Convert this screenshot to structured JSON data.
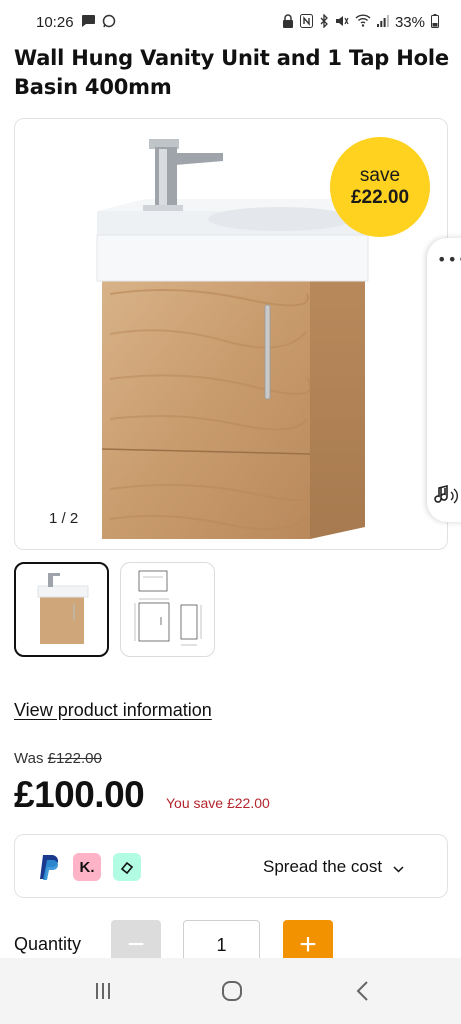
{
  "status_bar": {
    "time": "10:26",
    "battery": "33%",
    "icons": [
      "chat-icon",
      "whatsapp-icon",
      "lock-icon",
      "nfc-icon",
      "bluetooth-icon",
      "mute-icon",
      "wifi-icon",
      "signal-icon",
      "battery-icon"
    ]
  },
  "product": {
    "title_line1": "Wall Hung Vanity Unit and 1 Tap Hole",
    "title_line2": "Basin 400mm"
  },
  "gallery": {
    "save_badge_line1": "save",
    "save_badge_line2": "£22.00",
    "counter": "1 / 2",
    "badge_color": "#ffd21f"
  },
  "links": {
    "view_product_info": "View product information"
  },
  "pricing": {
    "was_label": "Was",
    "was_price": "£122.00",
    "price": "£100.00",
    "you_save": "You save £22.00"
  },
  "finance": {
    "klarna_label": "K.",
    "spread_label": "Spread the cost",
    "chevron": "⌄"
  },
  "quantity": {
    "label": "Quantity",
    "value": "1",
    "minus": "−",
    "plus": "+",
    "accent_color": "#f39200"
  }
}
